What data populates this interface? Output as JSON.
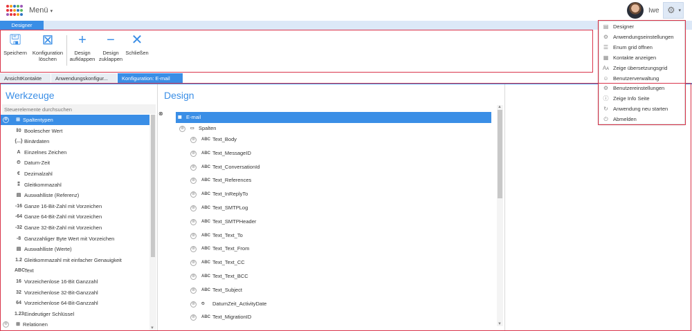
{
  "header": {
    "menu_label": "Menü",
    "menu_caret": "▾",
    "user_name": "Iwe",
    "gear_caret": "▾",
    "logo_colors": [
      "#e8333a",
      "#f6a11a",
      "#2f74c0",
      "#5cb85c",
      "#9b59b6",
      "#e8333a"
    ]
  },
  "ribbon": {
    "tab_label": "Designer",
    "buttons": [
      {
        "label": "Speichern",
        "icon": "save-icon",
        "glyph": "🖫"
      },
      {
        "label": "Konfiguration löschen",
        "icon": "delete-config-icon",
        "glyph": "⊠"
      },
      {
        "label": "Design aufklappen",
        "icon": "expand-icon",
        "glyph": "+"
      },
      {
        "label": "Design zuklappen",
        "icon": "collapse-icon",
        "glyph": "−"
      },
      {
        "label": "Schließen",
        "icon": "close-icon",
        "glyph": "✕"
      }
    ]
  },
  "doc_tabs": [
    {
      "label": "AnsichtKontakte",
      "active": false
    },
    {
      "label": "Anwendungskonfigur...",
      "active": false
    },
    {
      "label": "Konfiguration: E-mail",
      "active": true
    }
  ],
  "tools": {
    "title": "Werkzeuge",
    "search_placeholder": "Steuerelemente durchsuchen",
    "items": [
      {
        "label": "Spaltentypen",
        "icon": "grid-icon",
        "glyph": "⊞",
        "expand": "⊗",
        "top": true,
        "selected": true
      },
      {
        "label": "Boolescher Wert",
        "icon": "boolean-icon",
        "glyph": "‖0"
      },
      {
        "label": "Binärdaten",
        "icon": "binary-icon",
        "glyph": "{...}"
      },
      {
        "label": "Einzelnes Zeichen",
        "icon": "char-icon",
        "glyph": "A"
      },
      {
        "label": "Datum-Zeit",
        "icon": "datetime-icon",
        "glyph": "⏲"
      },
      {
        "label": "Dezimalzahl",
        "icon": "decimal-icon",
        "glyph": "€"
      },
      {
        "label": "Gleitkommazahl",
        "icon": "float-icon",
        "glyph": "⁑"
      },
      {
        "label": "Auswahlliste (Referenz)",
        "icon": "lookup-reference-icon",
        "glyph": "▤"
      },
      {
        "label": "Ganze 16-Bit-Zahl mit Vorzeichen",
        "icon": "int16-icon",
        "glyph": "-16"
      },
      {
        "label": "Ganze 64-Bit-Zahl mit Vorzeichen",
        "icon": "int64-icon",
        "glyph": "-64"
      },
      {
        "label": "Ganze 32-Bit-Zahl mit Vorzeichen",
        "icon": "int32-icon",
        "glyph": "-32"
      },
      {
        "label": "Ganzzahliger Byte Wert mit Vorzeichen",
        "icon": "sbyte-icon",
        "glyph": "-8"
      },
      {
        "label": "Auswahlliste (Werte)",
        "icon": "lookup-values-icon",
        "glyph": "▤"
      },
      {
        "label": "Gleitkommazahl mit einfacher Genauigkeit",
        "icon": "single-icon",
        "glyph": "1.2"
      },
      {
        "label": "Text",
        "icon": "text-icon",
        "glyph": "ABC"
      },
      {
        "label": "Vorzeichenlose 16-Bit Ganzzahl",
        "icon": "uint16-icon",
        "glyph": "16"
      },
      {
        "label": "Vorzeichenlose 32-Bit-Ganzzahl",
        "icon": "uint32-icon",
        "glyph": "32"
      },
      {
        "label": "Vorzeichenlose 64-Bit-Ganzzahl",
        "icon": "uint64-icon",
        "glyph": "64"
      },
      {
        "label": "Eindeutiger Schlüssel",
        "icon": "unique-key-icon",
        "glyph": "1.23"
      },
      {
        "label": "Relationen",
        "icon": "grid-icon",
        "glyph": "⊞",
        "expand": "⊗",
        "top": true
      }
    ]
  },
  "design": {
    "title": "Design",
    "root_label": "E-mail",
    "root_glyph": "▦",
    "group_label": "Spalten",
    "group_glyph": "▭",
    "fields": [
      {
        "label": "Text_Body",
        "glyph": "ABC"
      },
      {
        "label": "Text_MessageID",
        "glyph": "ABC"
      },
      {
        "label": "Text_ConversationId",
        "glyph": "ABC"
      },
      {
        "label": "Text_References",
        "glyph": "ABC"
      },
      {
        "label": "Text_InReplyTo",
        "glyph": "ABC"
      },
      {
        "label": "Text_SMTPLog",
        "glyph": "ABC"
      },
      {
        "label": "Text_SMTPHeader",
        "glyph": "ABC"
      },
      {
        "label": "Text_Text_To",
        "glyph": "ABC"
      },
      {
        "label": "Text_Text_From",
        "glyph": "ABC"
      },
      {
        "label": "Text_Text_CC",
        "glyph": "ABC"
      },
      {
        "label": "Text_Text_BCC",
        "glyph": "ABC"
      },
      {
        "label": "Text_Subject",
        "glyph": "ABC"
      },
      {
        "label": "DatumZeit_ActivityDate",
        "glyph": "⏲"
      },
      {
        "label": "Text_MigrationID",
        "glyph": "ABC"
      }
    ]
  },
  "user_menu": {
    "items": [
      {
        "label": "Designer",
        "icon": "designer-icon",
        "glyph": "▤"
      },
      {
        "label": "Anwendungseinstellungen",
        "icon": "app-settings-icon",
        "glyph": "⚙"
      },
      {
        "label": "Enum grid öffnen",
        "icon": "enum-grid-icon",
        "glyph": "☰"
      },
      {
        "label": "Kontakte anzeigen",
        "icon": "contacts-icon",
        "glyph": "▦"
      },
      {
        "label": "Zeige übersetzungsgrid",
        "icon": "translation-icon",
        "glyph": "Aᴀ"
      },
      {
        "label": "Benutzerverwaltung",
        "icon": "user-management-icon",
        "glyph": "☺"
      },
      {
        "label": "Benutzereinstellungen",
        "icon": "user-settings-icon",
        "glyph": "⚙"
      },
      {
        "label": "Zeige Info Seite",
        "icon": "info-icon",
        "glyph": "ⓘ"
      },
      {
        "label": "Anwendung neu starten",
        "icon": "restart-icon",
        "glyph": "↻"
      },
      {
        "label": "Abmelden",
        "icon": "logout-icon",
        "glyph": "⏻"
      }
    ]
  },
  "colors": {
    "accent": "#3a8ee6",
    "highlight_frame": "#d9334a"
  }
}
